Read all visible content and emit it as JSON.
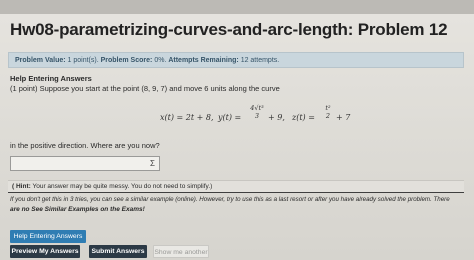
{
  "header": {
    "title": "Hw08-parametrizing-curves-and-arc-length: Problem 12"
  },
  "info_bar": {
    "problem_value_label": "Problem Value:",
    "problem_value": "1 point(s).",
    "problem_score_label": "Problem Score:",
    "problem_score": "0%.",
    "attempts_label": "Attempts Remaining:",
    "attempts": "12 attempts."
  },
  "problem": {
    "help_heading": "Help Entering Answers",
    "text": "(1 point) Suppose you start at the point (8, 9, 7) and move 6 units along the curve",
    "eq_x": "x(t) = 2t + 8,",
    "eq_y_prefix": "y(t) =",
    "eq_y_num": "4√t³",
    "eq_y_den": "3",
    "eq_y_suffix": "+ 9,",
    "eq_z_prefix": "z(t) =",
    "eq_z_num": "t²",
    "eq_z_den": "2",
    "eq_z_suffix": "+ 7",
    "direction_text": "in the positive direction. Where are you now?"
  },
  "answer": {
    "value": "",
    "sigma_label": "Σ"
  },
  "hint": {
    "label": "( Hint:",
    "text": "Your answer may be quite messy. You do not need to simplify.)"
  },
  "notes": {
    "line1": "If you don't get this in 3 tries, you can see a similar example (online). However, try to use this as a last resort or after you have already solved the problem. There",
    "line2": "are no See Similar Examples on the Exams!"
  },
  "buttons": {
    "help_entering": "Help Entering Answers",
    "preview": "Preview My Answers",
    "submit": "Submit Answers",
    "show_another": "Show me another"
  },
  "colors": {
    "info_bar_bg": "#c9d6dd",
    "help_button": "#2f7db3",
    "dark_button": "#2c3a46"
  }
}
